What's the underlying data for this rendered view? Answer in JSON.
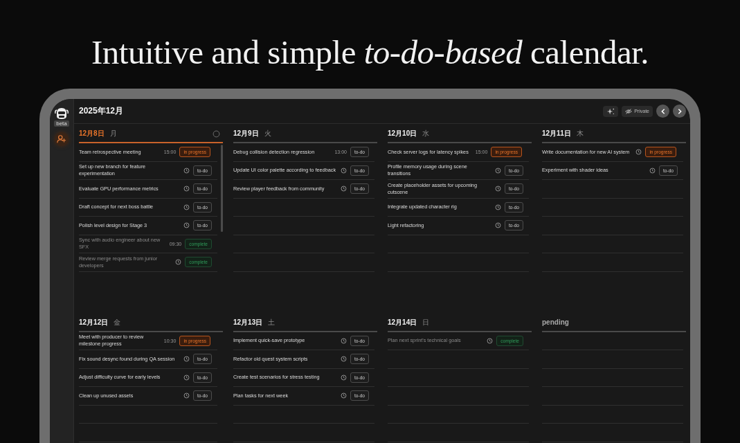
{
  "headline": "Intuitive and simple *to-do-based* calendar.",
  "sidebar": {
    "badge": "beta",
    "items": [
      {
        "kind": "add-user",
        "selected": true
      }
    ]
  },
  "header": {
    "title": "2025年12月",
    "privacy_button": "Private"
  },
  "weeks": [
    {
      "columns": [
        {
          "kind": "day",
          "date": "12月8日",
          "weekday": "月",
          "today": true,
          "tasks": [
            {
              "title": "Team retrospective meeting",
              "time": "15:00",
              "status": "in progress",
              "kind": "in_progress"
            },
            {
              "title": "Set up new branch for feature experimentation",
              "status": "to-do",
              "kind": "todo"
            },
            {
              "title": "Evaluate GPU performance metrics",
              "status": "to-do",
              "kind": "todo"
            },
            {
              "title": "Draft concept for next boss battle",
              "status": "to-do",
              "kind": "todo"
            },
            {
              "title": "Polish level design for Stage 3",
              "status": "to-do",
              "kind": "todo"
            },
            {
              "title": "Sync with audio engineer about new SFX",
              "time": "09:30",
              "status": "complete",
              "kind": "complete"
            },
            {
              "title": "Review merge requests from junior developers",
              "status": "complete",
              "kind": "complete"
            }
          ]
        },
        {
          "kind": "day",
          "date": "12月9日",
          "weekday": "火",
          "today": false,
          "tasks": [
            {
              "title": "Debug collision detection regression",
              "time": "13:00",
              "status": "to-do",
              "kind": "todo"
            },
            {
              "title": "Update UI color palette according to feedback",
              "status": "to-do",
              "kind": "todo"
            },
            {
              "title": "Review player feedback from community",
              "status": "to-do",
              "kind": "todo"
            }
          ]
        },
        {
          "kind": "day",
          "date": "12月10日",
          "weekday": "水",
          "today": false,
          "tasks": [
            {
              "title": "Check server logs for latency spikes",
              "time": "15:00",
              "status": "in progress",
              "kind": "in_progress"
            },
            {
              "title": "Profile memory usage during scene transitions",
              "status": "to-do",
              "kind": "todo"
            },
            {
              "title": "Create placeholder assets for upcoming cutscene",
              "status": "to-do",
              "kind": "todo"
            },
            {
              "title": "Integrate updated character rig",
              "status": "to-do",
              "kind": "todo"
            },
            {
              "title": "Light refactoring",
              "status": "to-do",
              "kind": "todo"
            }
          ]
        },
        {
          "kind": "day",
          "date": "12月11日",
          "weekday": "木",
          "today": false,
          "tasks": [
            {
              "title": "Write documentation for new AI system",
              "status": "in progress",
              "kind": "in_progress"
            },
            {
              "title": "Experiment with shader ideas",
              "status": "to-do",
              "kind": "todo"
            }
          ]
        }
      ]
    },
    {
      "columns": [
        {
          "kind": "day",
          "date": "12月12日",
          "weekday": "金",
          "today": false,
          "tasks": [
            {
              "title": "Meet with producer to review milestone progress",
              "time": "10:30",
              "status": "in progress",
              "kind": "in_progress"
            },
            {
              "title": "Fix sound desync found during QA session",
              "status": "to-do",
              "kind": "todo"
            },
            {
              "title": "Adjust difficulty curve for early levels",
              "status": "to-do",
              "kind": "todo"
            },
            {
              "title": "Clean up unused assets",
              "status": "to-do",
              "kind": "todo"
            }
          ]
        },
        {
          "kind": "day",
          "date": "12月13日",
          "weekday": "土",
          "today": false,
          "tasks": [
            {
              "title": "Implement quick-save prototype",
              "status": "to-do",
              "kind": "todo"
            },
            {
              "title": "Refactor old quest system scripts",
              "status": "to-do",
              "kind": "todo"
            },
            {
              "title": "Create test scenarios for stress testing",
              "status": "to-do",
              "kind": "todo"
            },
            {
              "title": "Plan tasks for next week",
              "status": "to-do",
              "kind": "todo"
            }
          ]
        },
        {
          "kind": "day",
          "date": "12月14日",
          "weekday": "日",
          "today": false,
          "tasks": [
            {
              "title": "Plan next sprint's technical goals",
              "status": "complete",
              "kind": "complete"
            }
          ]
        },
        {
          "kind": "pending",
          "date": "pending"
        }
      ]
    }
  ]
}
